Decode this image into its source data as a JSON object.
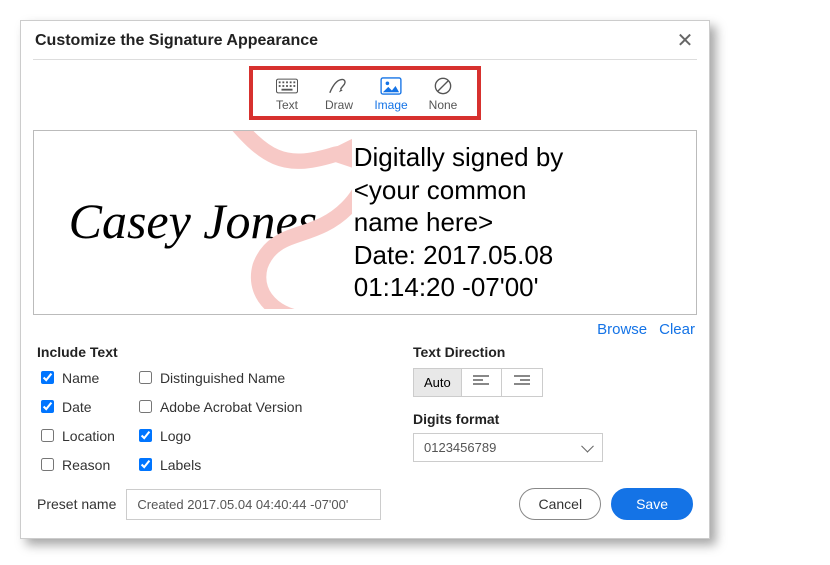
{
  "dialog": {
    "title": "Customize the Signature Appearance"
  },
  "modes": {
    "text": "Text",
    "draw": "Draw",
    "image": "Image",
    "none": "None"
  },
  "preview": {
    "signatureName": "Casey Jones",
    "line1": "Digitally signed by",
    "line2": "<your common",
    "line3": "name here>",
    "line4": "Date: 2017.05.08",
    "line5": "01:14:20 -07'00'"
  },
  "links": {
    "browse": "Browse",
    "clear": "Clear"
  },
  "include": {
    "heading": "Include Text",
    "name": "Name",
    "date": "Date",
    "location": "Location",
    "reason": "Reason",
    "distinguished": "Distinguished Name",
    "acrobat": "Adobe Acrobat Version",
    "logo": "Logo",
    "labels": "Labels"
  },
  "textdir": {
    "heading": "Text Direction",
    "auto": "Auto"
  },
  "digits": {
    "heading": "Digits format",
    "value": "0123456789"
  },
  "preset": {
    "label": "Preset name",
    "value": "Created 2017.05.04 04:40:44 -07'00'"
  },
  "buttons": {
    "cancel": "Cancel",
    "save": "Save"
  }
}
